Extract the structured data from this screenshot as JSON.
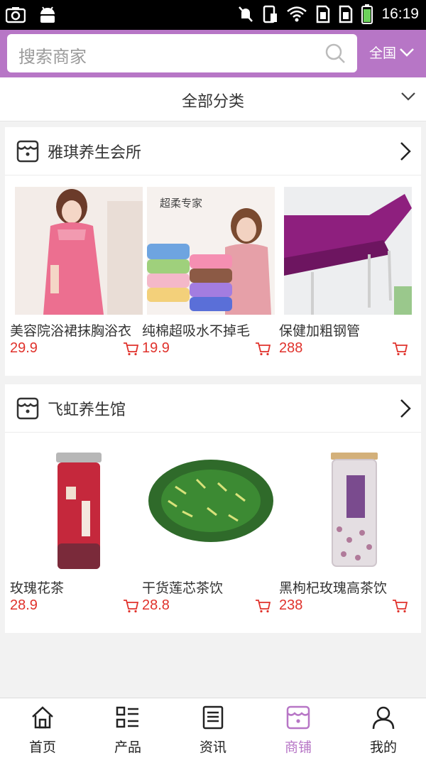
{
  "status_bar": {
    "time": "16:19",
    "icons": [
      "camera-icon",
      "android-icon",
      "mute-icon",
      "sim-icon",
      "wifi-icon",
      "sim1-icon",
      "sim2-icon",
      "battery-icon"
    ]
  },
  "search": {
    "placeholder": "搜索商家",
    "region": "全国"
  },
  "category": {
    "label": "全部分类"
  },
  "shops": [
    {
      "name": "雅琪养生会所",
      "products": [
        {
          "name": "美容院浴裙抹胸浴衣",
          "price": "29.9",
          "image": "pink-bath-dress"
        },
        {
          "name": "纯棉超吸水不掉毛",
          "price": "19.9",
          "image": "towel-stack",
          "image_caption": "超柔专家"
        },
        {
          "name": "保健加粗钢管",
          "price": "288",
          "image": "purple-massage-bed"
        }
      ]
    },
    {
      "name": "飞虹养生馆",
      "products": [
        {
          "name": "玫瑰花茶",
          "price": "28.9",
          "image": "rose-tea-jar"
        },
        {
          "name": "干货莲芯茶饮",
          "price": "28.8",
          "image": "lotus-seed-tea"
        },
        {
          "name": "黑枸杞玫瑰高茶饮",
          "price": "238",
          "image": "goji-rose-tea-jar"
        }
      ]
    }
  ],
  "tabs": [
    {
      "label": "首页",
      "icon": "home-icon"
    },
    {
      "label": "产品",
      "icon": "list-icon"
    },
    {
      "label": "资讯",
      "icon": "news-icon"
    },
    {
      "label": "商铺",
      "icon": "store-icon",
      "active": true
    },
    {
      "label": "我的",
      "icon": "user-icon"
    }
  ],
  "colors": {
    "accent": "#b776c6",
    "price": "#e0322c"
  }
}
